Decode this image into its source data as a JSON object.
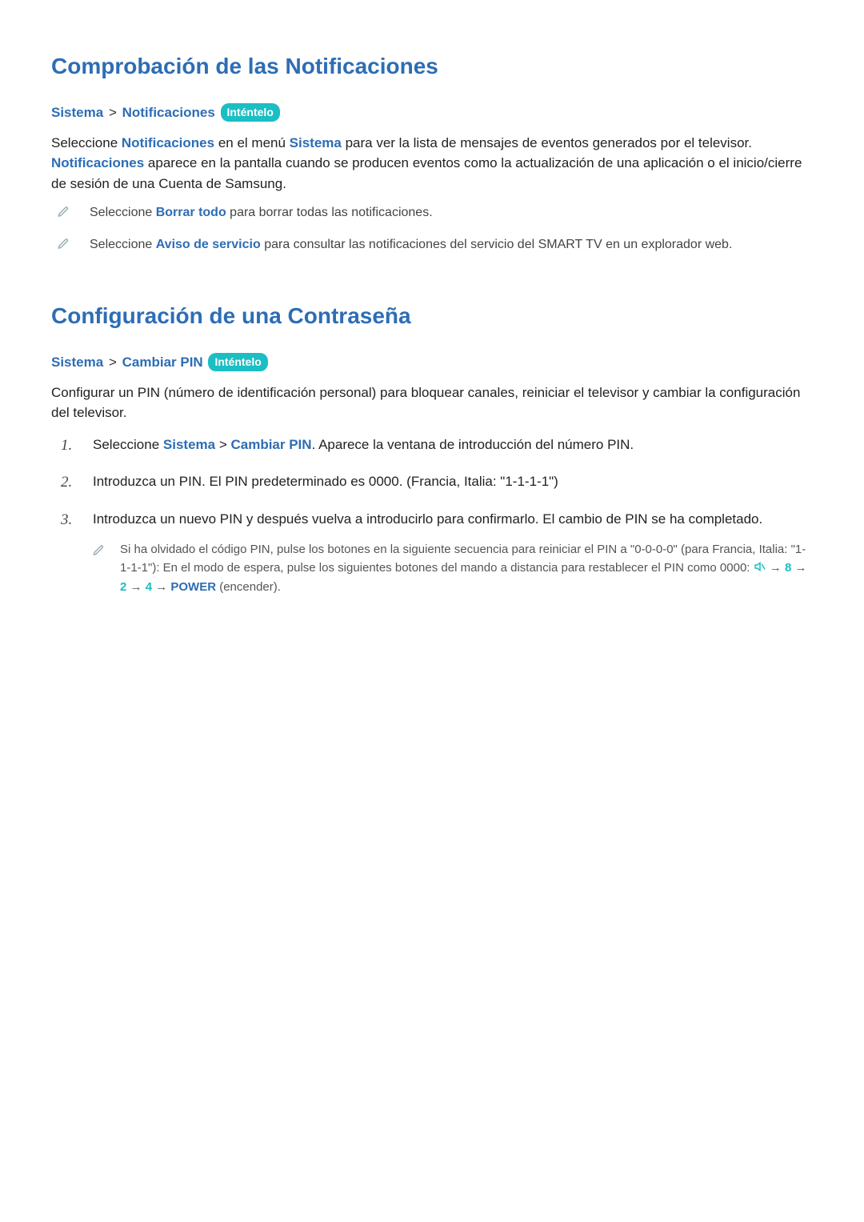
{
  "section1": {
    "title": "Comprobación de las Notificaciones",
    "crumb": {
      "a": "Sistema",
      "sep": ">",
      "b": "Notificaciones"
    },
    "pill": "Inténtelo",
    "p_parts": {
      "t1": "Seleccione ",
      "notif1": "Notificaciones",
      "t2": " en el menú ",
      "sistema": "Sistema",
      "t3": " para ver la lista de mensajes de eventos generados por el televisor. ",
      "notif2": "Notificaciones",
      "t4": " aparece en la pantalla cuando se producen eventos como la actualización de una aplicación o el inicio/cierre de sesión de una Cuenta de Samsung."
    },
    "bullets": [
      {
        "pre": "Seleccione ",
        "bold": "Borrar todo",
        "post": " para borrar todas las notificaciones."
      },
      {
        "pre": "Seleccione ",
        "bold": "Aviso de servicio",
        "post": " para consultar las notificaciones del servicio del SMART TV en un explorador web."
      }
    ]
  },
  "section2": {
    "title": "Configuración de una Contraseña",
    "crumb": {
      "a": "Sistema",
      "sep": ">",
      "b": "Cambiar PIN"
    },
    "pill": "Inténtelo",
    "p": "Configurar un PIN (número de identificación personal) para bloquear canales, reiniciar el televisor y cambiar la configuración del televisor.",
    "steps": {
      "s1": {
        "pre": "Seleccione ",
        "a": "Sistema",
        "sep": " > ",
        "b": "Cambiar PIN",
        "post": ". Aparece la ventana de introducción del número PIN."
      },
      "s2": "Introduzca un PIN. El PIN predeterminado es 0000. (Francia, Italia: \"1-1-1-1\")",
      "s3": "Introduzca un nuevo PIN y después vuelva a introducirlo para confirmarlo. El cambio de PIN se ha completado.",
      "note": {
        "t1": "Si ha olvidado el código PIN, pulse los botones en la siguiente secuencia para reiniciar el PIN a \"0-0-0-0\" (para Francia, Italia: \"1-1-1-1\"): En el modo de espera, pulse los siguientes botones del mando a distancia para restablecer el PIN como 0000: ",
        "arrow1": " → ",
        "n8": "8",
        "arrow2": " → ",
        "n2": "2",
        "arrow3": " → ",
        "n4": "4",
        "arrow4": " → ",
        "power": "POWER",
        "enc": " (encender)."
      }
    },
    "nums": {
      "n1": "1.",
      "n2": "2.",
      "n3": "3."
    }
  }
}
